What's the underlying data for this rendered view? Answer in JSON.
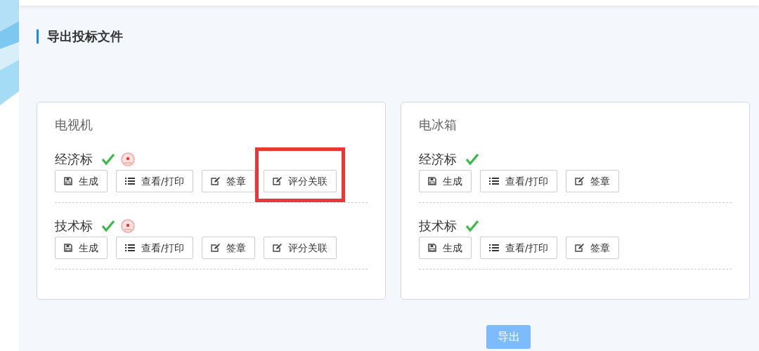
{
  "page": {
    "title": "导出投标文件"
  },
  "projects": [
    {
      "name": "电视机",
      "sections": [
        {
          "label": "经济标",
          "done": true,
          "stamped": true,
          "buttons": [
            {
              "kind": "save",
              "label": "生成",
              "highlighted": false
            },
            {
              "kind": "list",
              "label": "查看/打印",
              "highlighted": false
            },
            {
              "kind": "edit",
              "label": "签章",
              "highlighted": false
            },
            {
              "kind": "edit",
              "label": "评分关联",
              "highlighted": true
            }
          ]
        },
        {
          "label": "技术标",
          "done": true,
          "stamped": true,
          "buttons": [
            {
              "kind": "save",
              "label": "生成",
              "highlighted": false
            },
            {
              "kind": "list",
              "label": "查看/打印",
              "highlighted": false
            },
            {
              "kind": "edit",
              "label": "签章",
              "highlighted": false
            },
            {
              "kind": "edit",
              "label": "评分关联",
              "highlighted": false
            }
          ]
        }
      ]
    },
    {
      "name": "电冰箱",
      "sections": [
        {
          "label": "经济标",
          "done": true,
          "stamped": false,
          "buttons": [
            {
              "kind": "save",
              "label": "生成",
              "highlighted": false
            },
            {
              "kind": "list",
              "label": "查看/打印",
              "highlighted": false
            },
            {
              "kind": "edit",
              "label": "签章",
              "highlighted": false
            }
          ]
        },
        {
          "label": "技术标",
          "done": true,
          "stamped": false,
          "buttons": [
            {
              "kind": "save",
              "label": "生成",
              "highlighted": false
            },
            {
              "kind": "list",
              "label": "查看/打印",
              "highlighted": false
            },
            {
              "kind": "edit",
              "label": "签章",
              "highlighted": false
            }
          ]
        }
      ]
    }
  ],
  "export_button": {
    "label": "导出",
    "disabled": true
  }
}
